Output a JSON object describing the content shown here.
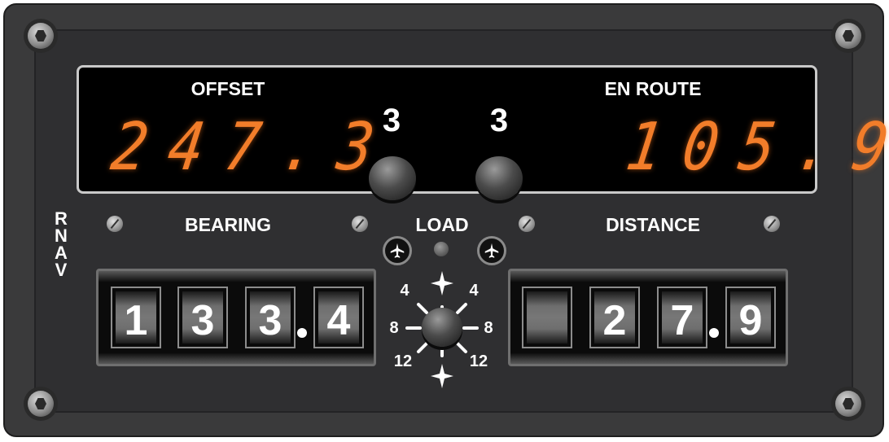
{
  "panel": {
    "mode_label": [
      "R",
      "N",
      "A",
      "V"
    ],
    "colors": {
      "plate": "#3a3a3b",
      "segment": "#f27d2a",
      "text": "#ffffff"
    }
  },
  "display": {
    "offset_label": "OFFSET",
    "offset_value": "247.3",
    "enroute_label": "EN ROUTE",
    "enroute_value": "105.9",
    "left_knob_value": "3",
    "right_knob_value": "3"
  },
  "bearing": {
    "label": "BEARING",
    "digits": [
      "1",
      "3",
      "3",
      "4"
    ]
  },
  "distance": {
    "label": "DISTANCE",
    "digits": [
      "",
      "2",
      "7",
      "9"
    ]
  },
  "load": {
    "label": "LOAD",
    "left_button_icon": "airplane-icon",
    "right_button_icon": "airplane-icon"
  },
  "selector": {
    "top_left": "4",
    "top_right": "4",
    "left": "8",
    "right": "8",
    "bottom_left": "12",
    "bottom_right": "12"
  }
}
